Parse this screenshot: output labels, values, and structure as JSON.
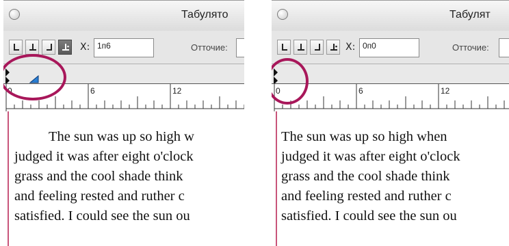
{
  "left_panel": {
    "title": "Табулято",
    "x_label": "X:",
    "x_value": "1п6",
    "leader_label": "Отточие:",
    "ruler_numbers": [
      "0",
      "6",
      "12"
    ],
    "text_lines": [
      "The sun was up so high w",
      "judged it was after eight o'clock",
      "grass and the cool shade think",
      "and feeling rested and ruther c",
      "satisfied. I could see the sun ou"
    ]
  },
  "right_panel": {
    "title": "Табулят",
    "x_label": "X:",
    "x_value": "0п0",
    "leader_label": "Отточие:",
    "ruler_numbers": [
      "0",
      "6",
      "12"
    ],
    "text_lines": [
      "The sun was up so high when",
      "judged it was after eight o'clock",
      "grass and the cool shade think",
      "and feeling rested and ruther c",
      "satisfied. I could see the sun ou"
    ]
  },
  "colors": {
    "highlight": "#a8175a",
    "margin_guide": "#c8557a",
    "tab_marker": "#2a7fd4"
  }
}
